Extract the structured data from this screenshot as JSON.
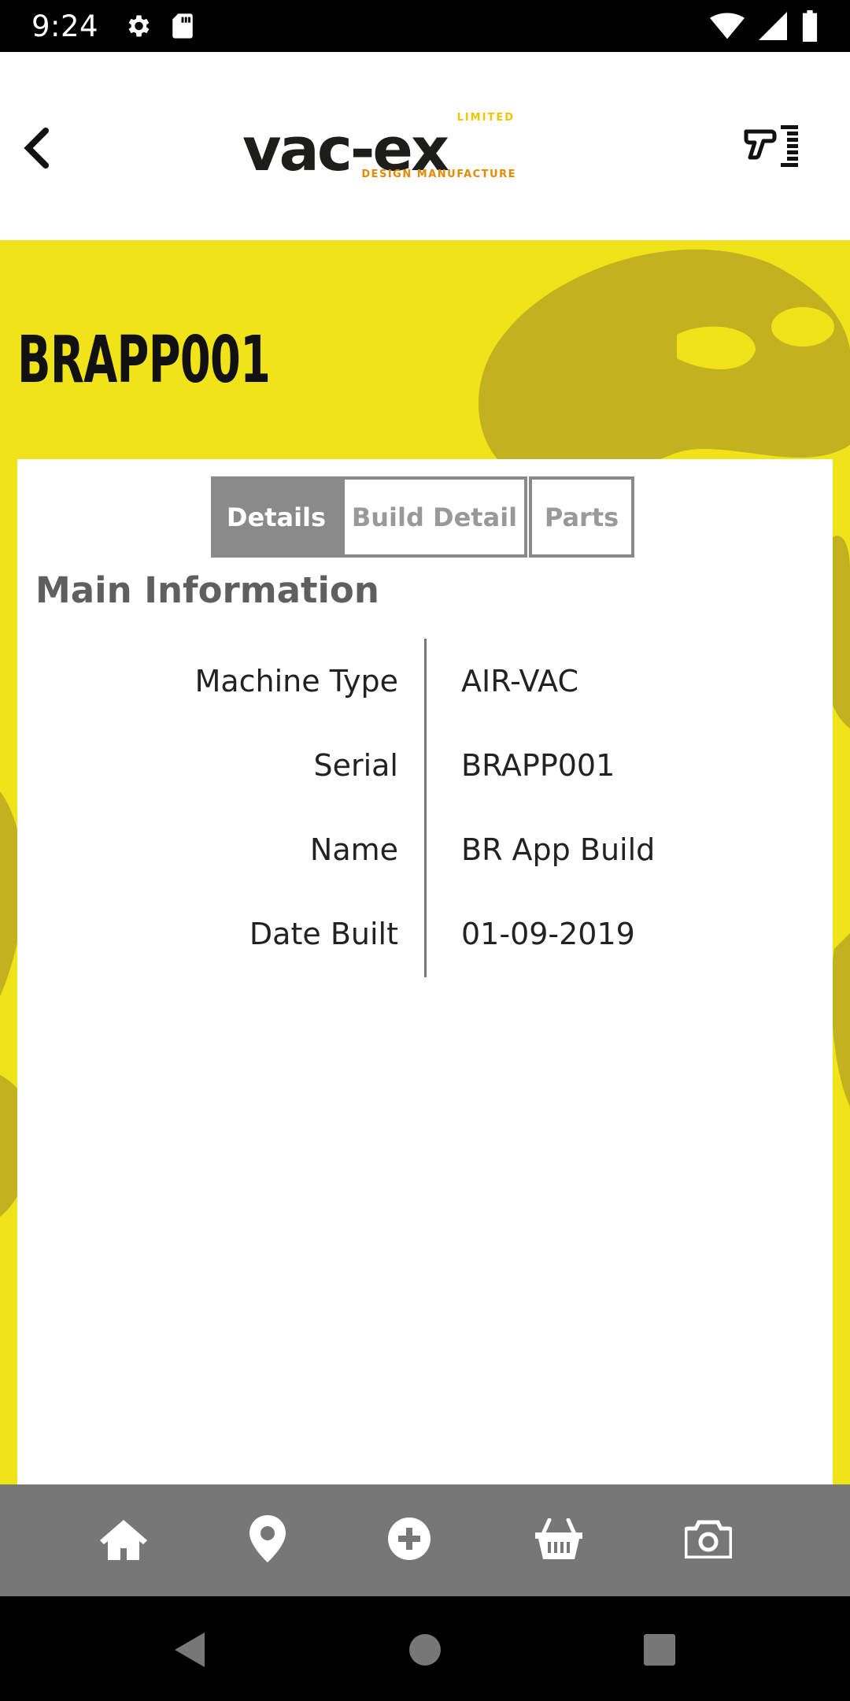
{
  "status_bar": {
    "time": "9:24",
    "left_icons": [
      "gear-icon",
      "sd-card-icon"
    ],
    "right_icons": [
      "wifi-icon",
      "signal-icon",
      "battery-icon"
    ]
  },
  "header": {
    "back_icon": "chevron-left-icon",
    "logo": {
      "main": "vac-ex",
      "tag": "LIMITED",
      "sub": "DESIGN MANUFACTURE"
    },
    "scanner_icon": "barcode-scanner-icon"
  },
  "page": {
    "title": "BRAPP001"
  },
  "tabs": [
    {
      "label": "Details",
      "active": true
    },
    {
      "label": "Build Detail",
      "active": false
    },
    {
      "label": "Parts",
      "active": false
    }
  ],
  "main_info": {
    "title": "Main Information",
    "rows": [
      {
        "label": "Machine Type",
        "value": "AIR-VAC"
      },
      {
        "label": "Serial",
        "value": "BRAPP001"
      },
      {
        "label": "Name",
        "value": "BR App Build"
      },
      {
        "label": "Date Built",
        "value": "01-09-2019"
      }
    ]
  },
  "bottom_nav": [
    {
      "icon": "home-icon"
    },
    {
      "icon": "map-pin-icon"
    },
    {
      "icon": "plus-circle-icon"
    },
    {
      "icon": "basket-icon"
    },
    {
      "icon": "camera-icon"
    }
  ],
  "system_nav": [
    "back-triangle-icon",
    "home-circle-icon",
    "recents-square-icon"
  ],
  "colors": {
    "accent_yellow": "#f0e31a",
    "tab_gray": "#8a8a8a",
    "nav_gray": "#777777",
    "logo_orange": "#e58a00"
  }
}
